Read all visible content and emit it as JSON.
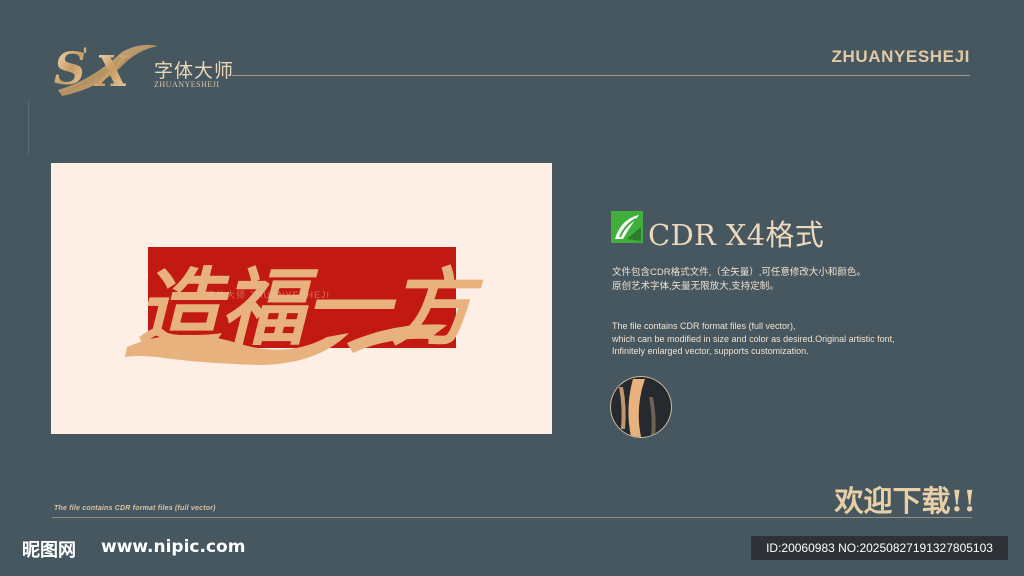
{
  "header": {
    "logo_mark": "S'X",
    "logo_cn": "字体大师",
    "logo_en": "ZHUANYESHEJI",
    "brand_right": "ZHUANYESHEJI"
  },
  "preview": {
    "artwork_text": "造福一方",
    "watermark": "字体大师 ZHUANYESHEJI"
  },
  "info": {
    "format_title": "CDR X4格式",
    "desc_cn": [
      "文件包含CDR格式文件,（全矢量）,可任意修改大小和颜色。",
      "原创艺术字体,矢量无限放大,支持定制。"
    ],
    "desc_en": [
      "The file contains CDR format files (full vector),",
      " which can be modified in size and color as desired.Original artistic font,",
      "Infinitely enlarged vector, supports customization."
    ]
  },
  "footer": {
    "note": "The file contains CDR format files (full vector)",
    "welcome": "欢迎下载!!",
    "nipic_logo": "昵图网",
    "nipic_url": "www.nipic.com",
    "id_text": "ID:20060983 NO:20250827191327805103"
  },
  "colors": {
    "background": "#465760",
    "gold": "#e9cfa6",
    "panel": "#fdefe6",
    "red": "#c21a12"
  }
}
